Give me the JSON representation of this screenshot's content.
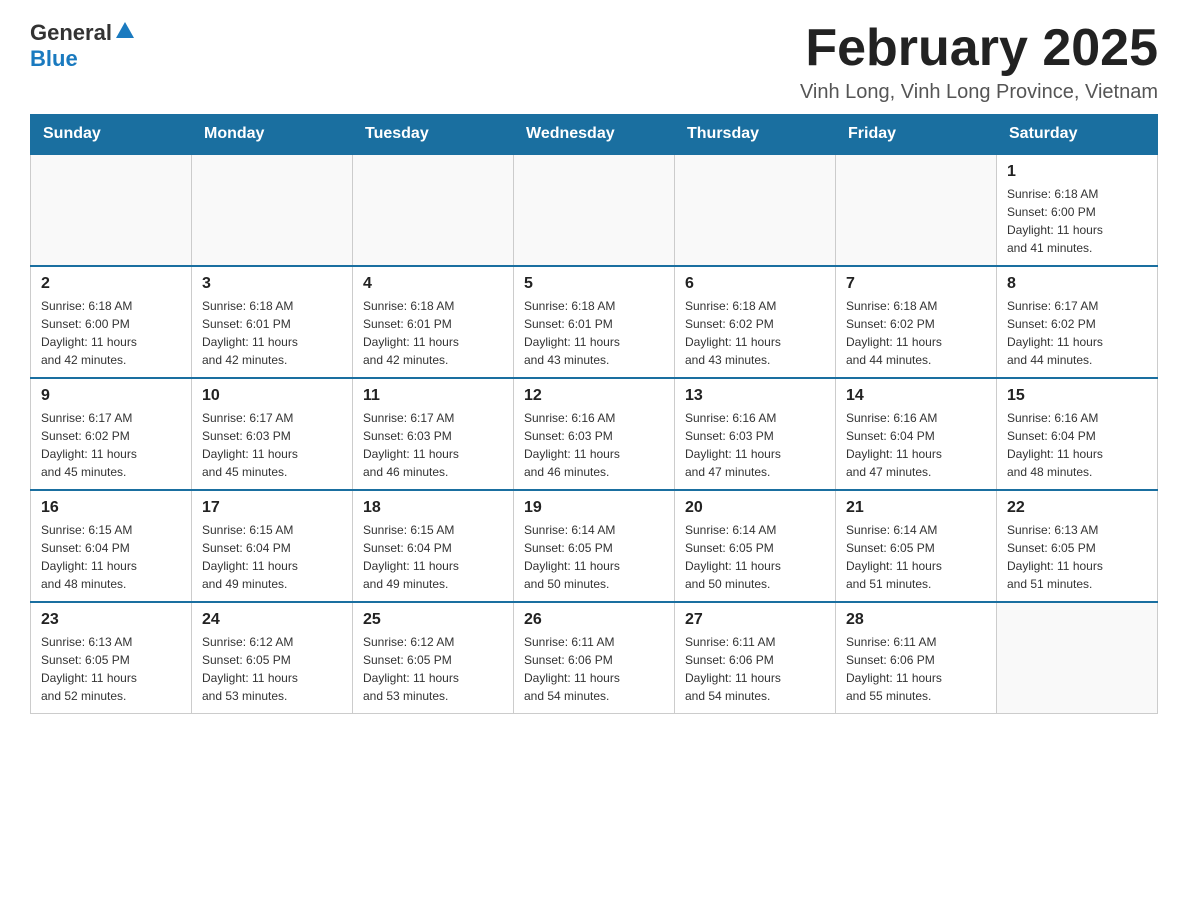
{
  "header": {
    "logo_general": "General",
    "logo_blue": "Blue",
    "title": "February 2025",
    "subtitle": "Vinh Long, Vinh Long Province, Vietnam"
  },
  "weekdays": [
    "Sunday",
    "Monday",
    "Tuesday",
    "Wednesday",
    "Thursday",
    "Friday",
    "Saturday"
  ],
  "weeks": [
    [
      {
        "day": "",
        "info": ""
      },
      {
        "day": "",
        "info": ""
      },
      {
        "day": "",
        "info": ""
      },
      {
        "day": "",
        "info": ""
      },
      {
        "day": "",
        "info": ""
      },
      {
        "day": "",
        "info": ""
      },
      {
        "day": "1",
        "info": "Sunrise: 6:18 AM\nSunset: 6:00 PM\nDaylight: 11 hours\nand 41 minutes."
      }
    ],
    [
      {
        "day": "2",
        "info": "Sunrise: 6:18 AM\nSunset: 6:00 PM\nDaylight: 11 hours\nand 42 minutes."
      },
      {
        "day": "3",
        "info": "Sunrise: 6:18 AM\nSunset: 6:01 PM\nDaylight: 11 hours\nand 42 minutes."
      },
      {
        "day": "4",
        "info": "Sunrise: 6:18 AM\nSunset: 6:01 PM\nDaylight: 11 hours\nand 42 minutes."
      },
      {
        "day": "5",
        "info": "Sunrise: 6:18 AM\nSunset: 6:01 PM\nDaylight: 11 hours\nand 43 minutes."
      },
      {
        "day": "6",
        "info": "Sunrise: 6:18 AM\nSunset: 6:02 PM\nDaylight: 11 hours\nand 43 minutes."
      },
      {
        "day": "7",
        "info": "Sunrise: 6:18 AM\nSunset: 6:02 PM\nDaylight: 11 hours\nand 44 minutes."
      },
      {
        "day": "8",
        "info": "Sunrise: 6:17 AM\nSunset: 6:02 PM\nDaylight: 11 hours\nand 44 minutes."
      }
    ],
    [
      {
        "day": "9",
        "info": "Sunrise: 6:17 AM\nSunset: 6:02 PM\nDaylight: 11 hours\nand 45 minutes."
      },
      {
        "day": "10",
        "info": "Sunrise: 6:17 AM\nSunset: 6:03 PM\nDaylight: 11 hours\nand 45 minutes."
      },
      {
        "day": "11",
        "info": "Sunrise: 6:17 AM\nSunset: 6:03 PM\nDaylight: 11 hours\nand 46 minutes."
      },
      {
        "day": "12",
        "info": "Sunrise: 6:16 AM\nSunset: 6:03 PM\nDaylight: 11 hours\nand 46 minutes."
      },
      {
        "day": "13",
        "info": "Sunrise: 6:16 AM\nSunset: 6:03 PM\nDaylight: 11 hours\nand 47 minutes."
      },
      {
        "day": "14",
        "info": "Sunrise: 6:16 AM\nSunset: 6:04 PM\nDaylight: 11 hours\nand 47 minutes."
      },
      {
        "day": "15",
        "info": "Sunrise: 6:16 AM\nSunset: 6:04 PM\nDaylight: 11 hours\nand 48 minutes."
      }
    ],
    [
      {
        "day": "16",
        "info": "Sunrise: 6:15 AM\nSunset: 6:04 PM\nDaylight: 11 hours\nand 48 minutes."
      },
      {
        "day": "17",
        "info": "Sunrise: 6:15 AM\nSunset: 6:04 PM\nDaylight: 11 hours\nand 49 minutes."
      },
      {
        "day": "18",
        "info": "Sunrise: 6:15 AM\nSunset: 6:04 PM\nDaylight: 11 hours\nand 49 minutes."
      },
      {
        "day": "19",
        "info": "Sunrise: 6:14 AM\nSunset: 6:05 PM\nDaylight: 11 hours\nand 50 minutes."
      },
      {
        "day": "20",
        "info": "Sunrise: 6:14 AM\nSunset: 6:05 PM\nDaylight: 11 hours\nand 50 minutes."
      },
      {
        "day": "21",
        "info": "Sunrise: 6:14 AM\nSunset: 6:05 PM\nDaylight: 11 hours\nand 51 minutes."
      },
      {
        "day": "22",
        "info": "Sunrise: 6:13 AM\nSunset: 6:05 PM\nDaylight: 11 hours\nand 51 minutes."
      }
    ],
    [
      {
        "day": "23",
        "info": "Sunrise: 6:13 AM\nSunset: 6:05 PM\nDaylight: 11 hours\nand 52 minutes."
      },
      {
        "day": "24",
        "info": "Sunrise: 6:12 AM\nSunset: 6:05 PM\nDaylight: 11 hours\nand 53 minutes."
      },
      {
        "day": "25",
        "info": "Sunrise: 6:12 AM\nSunset: 6:05 PM\nDaylight: 11 hours\nand 53 minutes."
      },
      {
        "day": "26",
        "info": "Sunrise: 6:11 AM\nSunset: 6:06 PM\nDaylight: 11 hours\nand 54 minutes."
      },
      {
        "day": "27",
        "info": "Sunrise: 6:11 AM\nSunset: 6:06 PM\nDaylight: 11 hours\nand 54 minutes."
      },
      {
        "day": "28",
        "info": "Sunrise: 6:11 AM\nSunset: 6:06 PM\nDaylight: 11 hours\nand 55 minutes."
      },
      {
        "day": "",
        "info": ""
      }
    ]
  ]
}
